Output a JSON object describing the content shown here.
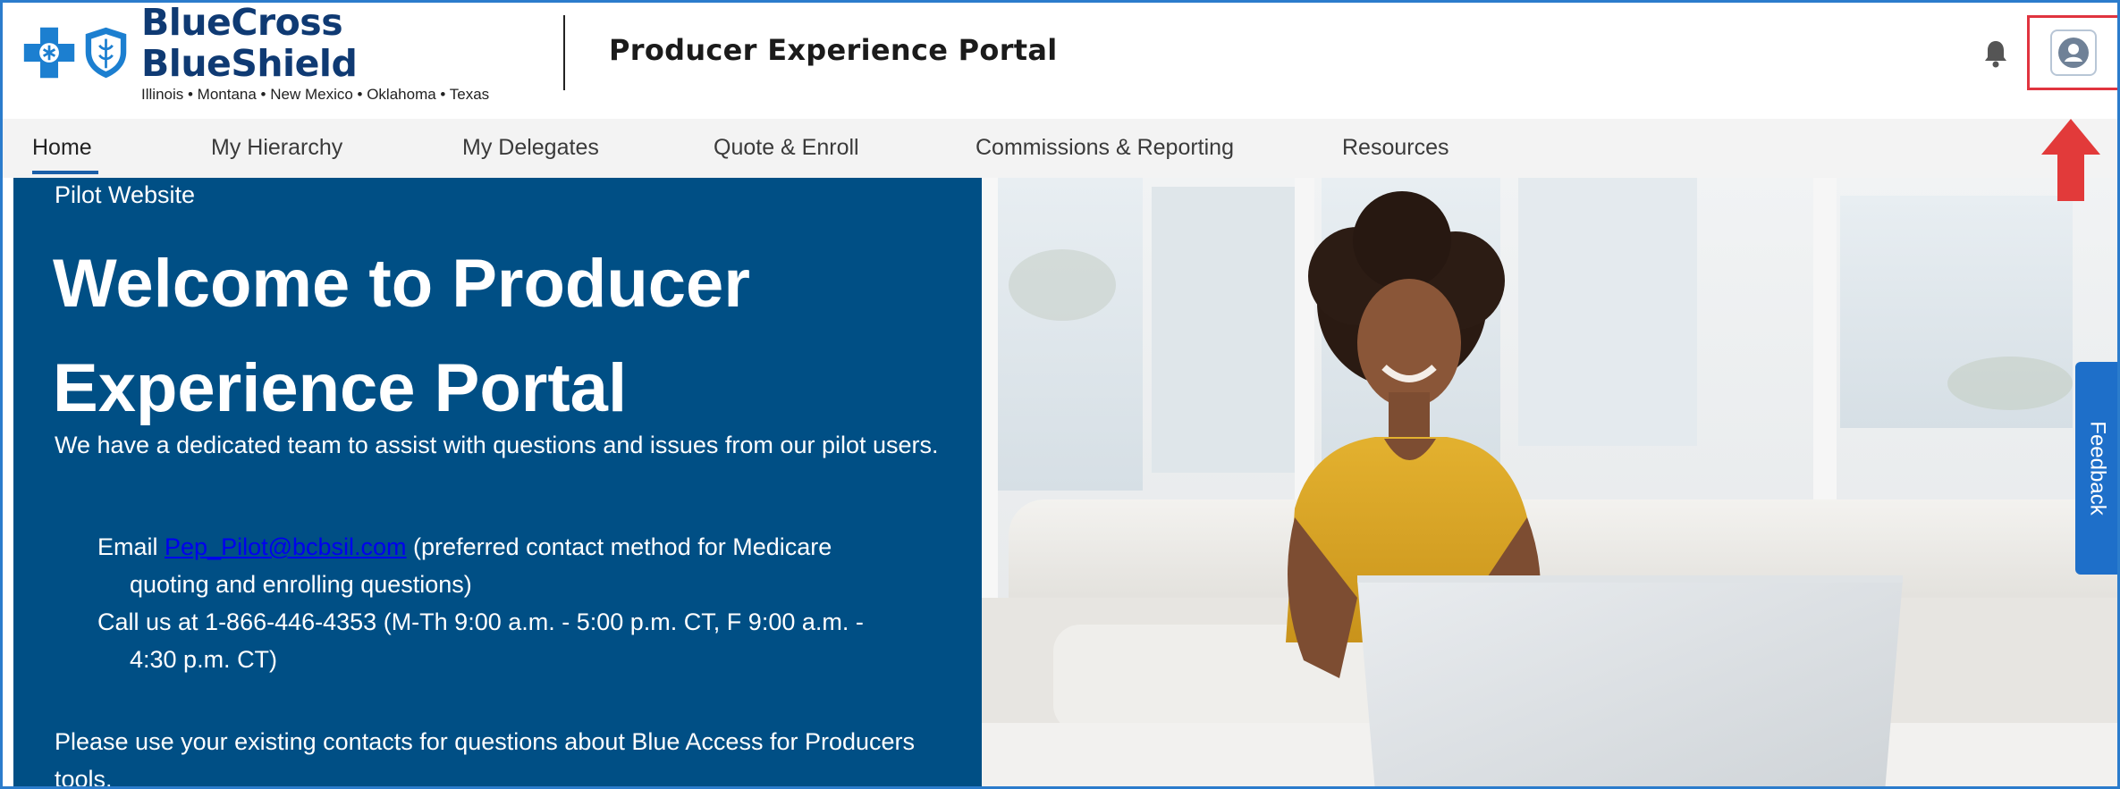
{
  "brand": {
    "name": "BlueCross BlueShield",
    "states": "Illinois • Montana • New Mexico • Oklahoma • Texas"
  },
  "header": {
    "portal_title": "Producer Experience Portal"
  },
  "nav": {
    "items": [
      {
        "label": "Home",
        "active": true
      },
      {
        "label": "My Hierarchy"
      },
      {
        "label": "My Delegates"
      },
      {
        "label": "Quote & Enroll"
      },
      {
        "label": "Commissions & Reporting"
      },
      {
        "label": "Resources"
      }
    ]
  },
  "hero": {
    "pilot_label": "Pilot Website",
    "title_line1": "Welcome to Producer",
    "title_line2": "Experience Portal",
    "intro": "We have a dedicated team to assist with questions and issues from our pilot users.",
    "email_prefix": "Email ",
    "email_link": "Pep_Pilot@bcbsil.com",
    "email_suffix_line1": " (preferred contact method for Medicare",
    "email_suffix_line2": "quoting and enrolling questions)",
    "call_line1": "Call us at 1-866-446-4353 (M-Th 9:00 a.m. - 5:00 p.m. CT, F 9:00 a.m. -",
    "call_line2": "4:30 p.m. CT)",
    "closing": "Please use your existing contacts for questions about Blue Access for Producers tools."
  },
  "feedback": {
    "label": "Feedback"
  },
  "icons": {
    "bell": "bell-icon",
    "avatar": "user-avatar-icon",
    "arrow": "red-arrow-up-icon"
  },
  "colors": {
    "brand_blue": "#0f3a73",
    "panel_blue": "#004f85",
    "feedback_blue": "#1e6fc9",
    "highlight_red": "#e0343f"
  }
}
